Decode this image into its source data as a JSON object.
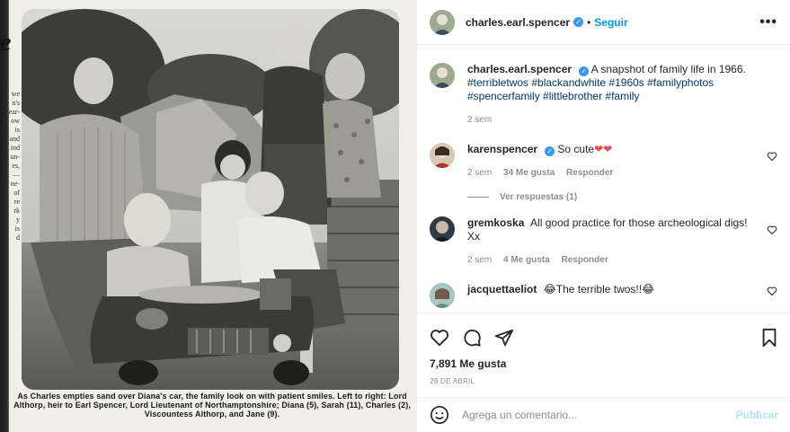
{
  "post": {
    "author": "charles.earl.spencer",
    "follow_label": "Seguir",
    "dot": "•",
    "more_icon": "more-horizontal-icon",
    "caption": "A snapshot of family life in 1966.",
    "hashtags": "#terribletwos #blackandwhite #1960s #familyphotos #spencerfamily #littlebrother #family",
    "caption_age": "2 sem",
    "likes": "7,891 Me gusta",
    "date": "28 DE ABRIL"
  },
  "clipping": {
    "big_letter": "e",
    "side_text": "we\nn's\near-\now\nis\nand\nind\nun-\nes,\n—\nne-\nof\nre\nrk\ny\nis\nd",
    "caption_text": "As Charles empties sand over Diana's car, the family look on with patient smiles. Left to right: Lord Althorp, heir to Earl Spencer, Lord Lieutenant of Northamptonshire; Diana (5), Sarah (11), Charles (2), Viscountess Althorp, and Jane (9)."
  },
  "comments": [
    {
      "user": "karenspencer",
      "verified": true,
      "text": "So cute",
      "emoji": "❤❤",
      "age": "2 sem",
      "likes": "34 Me gusta",
      "reply_label": "Responder",
      "view_replies": "Ver respuestas (1)"
    },
    {
      "user": "gremkoska",
      "verified": false,
      "text": "All good practice for those archeological digs! Xx",
      "age": "2 sem",
      "likes": "4 Me gusta",
      "reply_label": "Responder"
    },
    {
      "user": "jacquettaeliot",
      "verified": false,
      "text": "The terrible twos!!",
      "emoji_before": "😂",
      "emoji_after": "😂"
    }
  ],
  "composer": {
    "placeholder": "Agrega un comentario...",
    "publish_label": "Publicar"
  },
  "colors": {
    "link_blue": "#0095f6",
    "hashtag_blue": "#00376b",
    "muted": "#8e8e8e",
    "heart_red": "#ed4956"
  }
}
